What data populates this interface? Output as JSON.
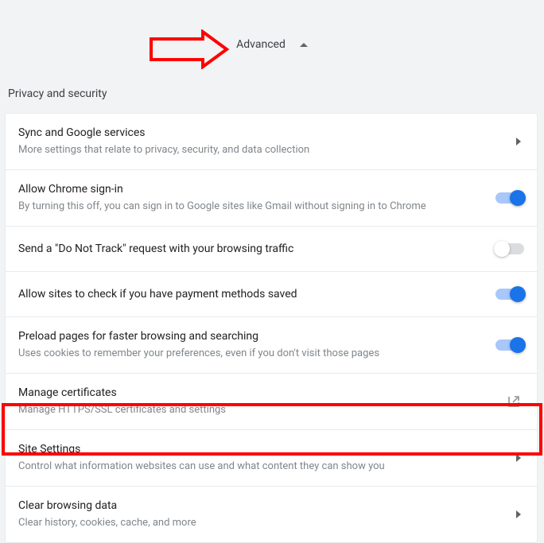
{
  "advanced": {
    "label": "Advanced"
  },
  "section": {
    "title": "Privacy and security"
  },
  "items": [
    {
      "title": "Sync and Google services",
      "subtitle": "More settings that relate to privacy, security, and data collection",
      "control": "chevron"
    },
    {
      "title": "Allow Chrome sign-in",
      "subtitle": "By turning this off, you can sign in to Google sites like Gmail without signing in to Chrome",
      "control": "toggle",
      "toggle_on": true
    },
    {
      "title": "Send a \"Do Not Track\" request with your browsing traffic",
      "subtitle": "",
      "control": "toggle",
      "toggle_on": false
    },
    {
      "title": "Allow sites to check if you have payment methods saved",
      "subtitle": "",
      "control": "toggle",
      "toggle_on": true
    },
    {
      "title": "Preload pages for faster browsing and searching",
      "subtitle": "Uses cookies to remember your preferences, even if you don't visit those pages",
      "control": "toggle",
      "toggle_on": true
    },
    {
      "title": "Manage certificates",
      "subtitle": "Manage HTTPS/SSL certificates and settings",
      "control": "external"
    },
    {
      "title": "Site Settings",
      "subtitle": "Control what information websites can use and what content they can show you",
      "control": "chevron"
    },
    {
      "title": "Clear browsing data",
      "subtitle": "Clear history, cookies, cache, and more",
      "control": "chevron"
    }
  ],
  "annotation": {
    "highlighted_item_index": 6
  }
}
